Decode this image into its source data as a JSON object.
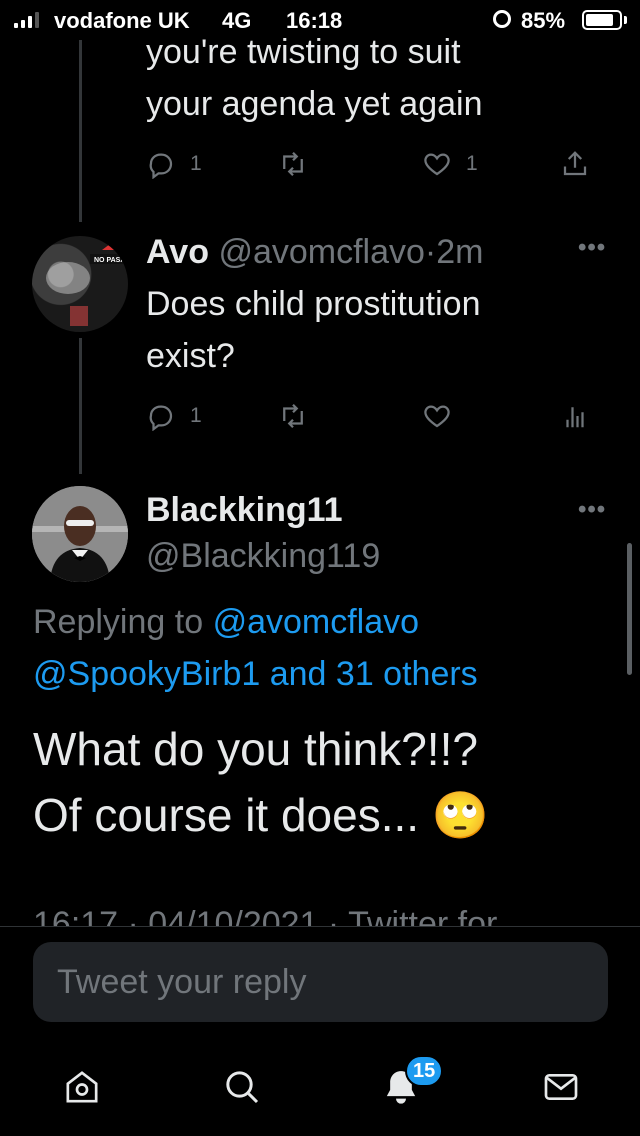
{
  "status_bar": {
    "carrier": "vodafone UK",
    "network": "4G",
    "time": "16:18",
    "battery_percent_label": "85%",
    "battery_level": 0.85
  },
  "tweet_1": {
    "text_line_1": "you're twisting to suit",
    "text_line_2": "your agenda yet again",
    "reply_count": "1",
    "like_count": "1"
  },
  "tweet_2": {
    "name": "Avo",
    "handle": "@avomcflavo",
    "separator": "·",
    "time_ago": "2m",
    "text_line_1": "Does child prostitution",
    "text_line_2": "exist?",
    "reply_count": "1"
  },
  "tweet_3": {
    "name": "Blackking11",
    "handle": "@Blackking119",
    "replying_prefix": "Replying to",
    "replying_handle": "@avomcflavo",
    "replying_line_2": "@SpookyBirb1 and 31 others",
    "text_line_1": "What do you think?!!?",
    "text_line_2": "Of course it does...",
    "emoji": "🙄",
    "meta": "16:17 · 04/10/2021 · Twitter for"
  },
  "reply_box": {
    "placeholder": "Tweet your reply"
  },
  "tab_bar": {
    "notifications_badge": "15"
  },
  "colors": {
    "accent": "#1d9bf0",
    "muted": "#71767b",
    "background": "#000000"
  },
  "icons": [
    "signal-icon",
    "alarm-icon",
    "battery-icon",
    "reply-icon",
    "retweet-icon",
    "like-icon",
    "share-icon",
    "analytics-icon",
    "more-icon",
    "home-icon",
    "search-icon",
    "notifications-icon",
    "messages-icon"
  ]
}
